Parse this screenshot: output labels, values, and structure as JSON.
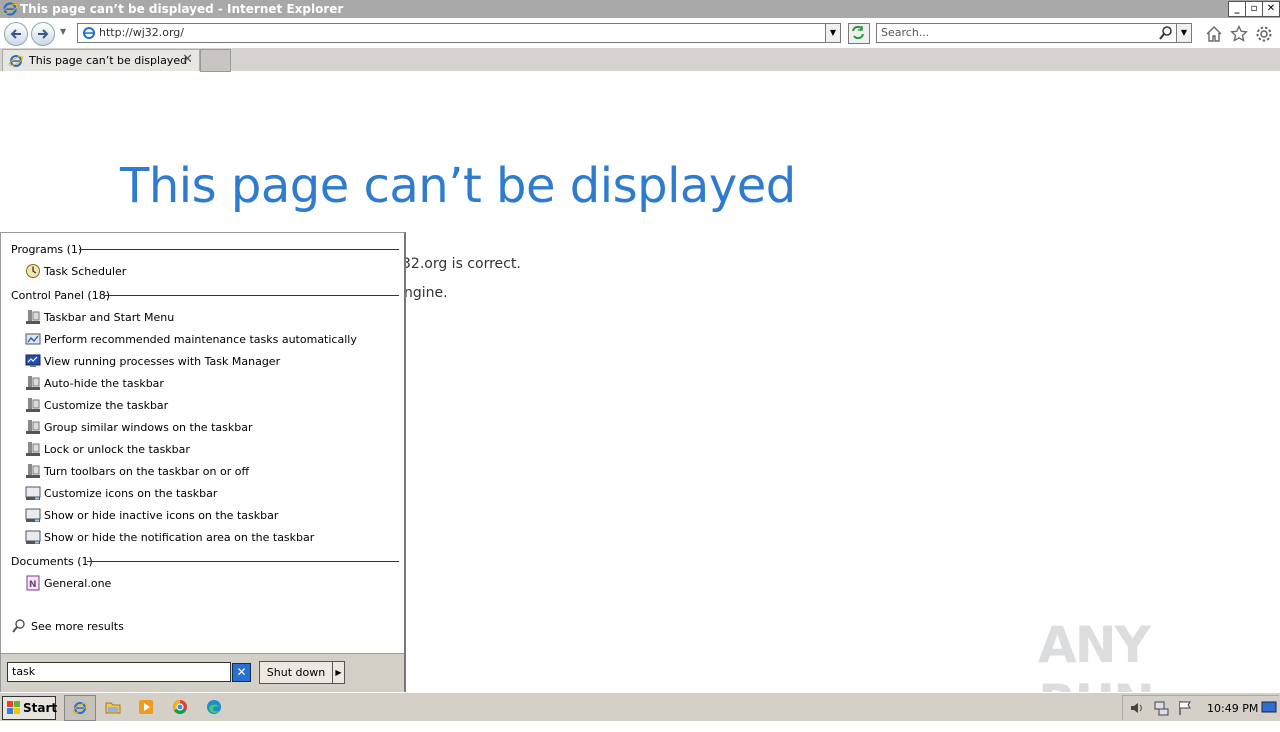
{
  "window": {
    "title": "This page can’t be displayed - Internet Explorer",
    "controls": [
      "minimize",
      "restore",
      "close"
    ]
  },
  "navbar": {
    "address": "http://wj32.org/",
    "search_placeholder": "Search..."
  },
  "tabs": [
    {
      "label": "This page can’t be displayed",
      "close": "✕"
    }
  ],
  "page": {
    "heading": "This page can’t be displayed",
    "line1": "32.org is correct.",
    "line2": "ngine."
  },
  "start_menu": {
    "sections": [
      {
        "title": "Programs (1)",
        "items": [
          {
            "label": "Task Scheduler",
            "icon": "clock-icon"
          }
        ]
      },
      {
        "title": "Control Panel (18)",
        "items": [
          {
            "label": "Taskbar and Start Menu",
            "icon": "taskbar-settings-icon"
          },
          {
            "label": "Perform recommended maintenance tasks automatically",
            "icon": "action-center-icon"
          },
          {
            "label": "View running processes with Task Manager",
            "icon": "monitor-icon"
          },
          {
            "label": "Auto-hide the taskbar",
            "icon": "taskbar-settings-icon"
          },
          {
            "label": "Customize the taskbar",
            "icon": "taskbar-settings-icon"
          },
          {
            "label": "Group similar windows on the taskbar",
            "icon": "taskbar-settings-icon"
          },
          {
            "label": "Lock or unlock the taskbar",
            "icon": "taskbar-settings-icon"
          },
          {
            "label": "Turn toolbars on the taskbar on or off",
            "icon": "taskbar-settings-icon"
          },
          {
            "label": "Customize icons on the taskbar",
            "icon": "notification-area-icon"
          },
          {
            "label": "Show or hide inactive icons on the taskbar",
            "icon": "notification-area-icon"
          },
          {
            "label": "Show or hide the notification area on the taskbar",
            "icon": "notification-area-icon"
          }
        ]
      },
      {
        "title": "Documents (1)",
        "items": [
          {
            "label": "General.one",
            "icon": "onenote-icon"
          }
        ]
      }
    ],
    "see_more": "See more results",
    "search_value": "task",
    "shutdown_label": "Shut down"
  },
  "watermark": {
    "text": "ANY RUN"
  },
  "taskbar": {
    "start_label": "Start",
    "pinned": [
      "internet-explorer-icon",
      "file-explorer-icon",
      "media-player-icon",
      "chrome-icon",
      "edge-icon"
    ],
    "clock": "10:49 PM"
  },
  "colors": {
    "heading_blue": "#2e7bcf",
    "titlebar_gray": "#a9a9a9",
    "taskbar_gray": "#d4d0c8"
  }
}
